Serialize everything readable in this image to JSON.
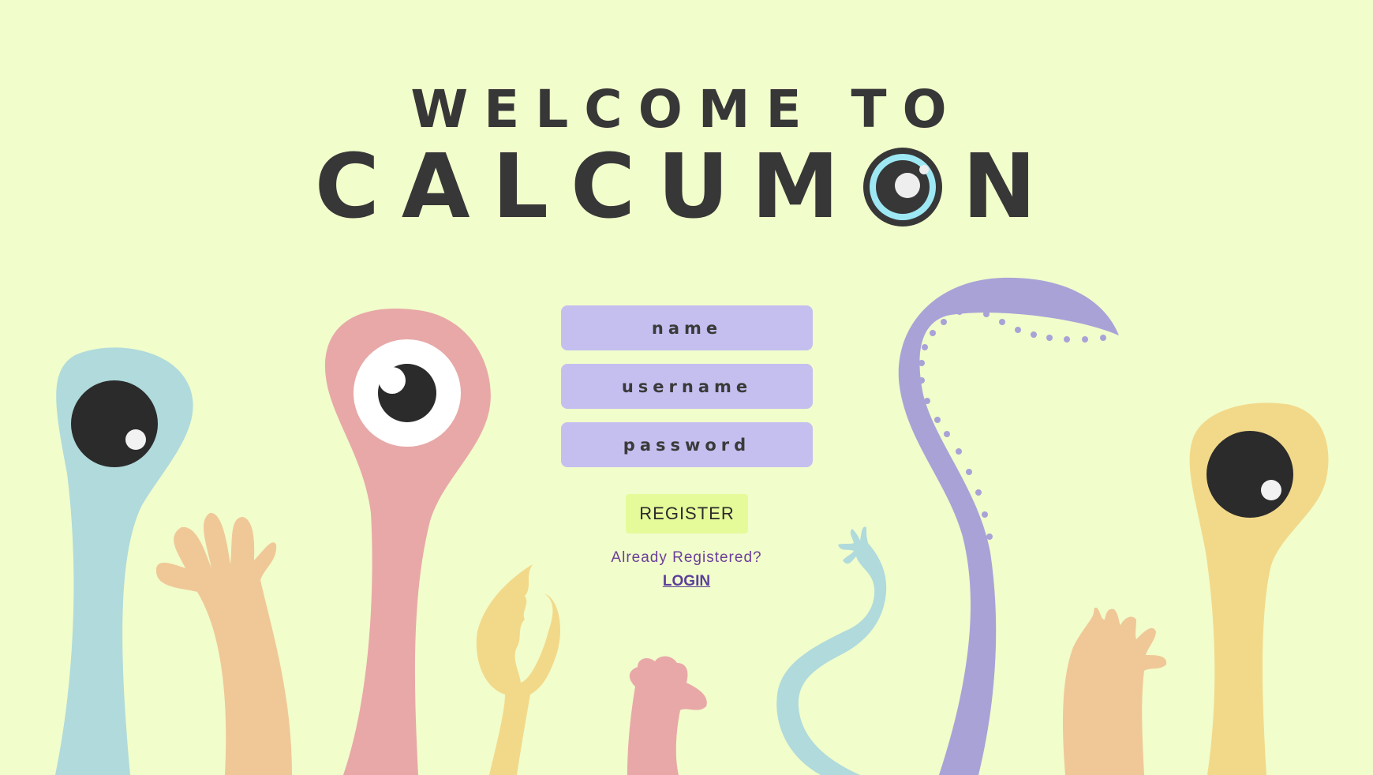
{
  "header": {
    "welcome_text": "WELCOME TO",
    "brand_prefix": "CALCUM",
    "brand_suffix": "N"
  },
  "form": {
    "name_placeholder": "name",
    "username_placeholder": "username",
    "password_placeholder": "password",
    "register_label": "REGISTER",
    "already_text": "Already Registered?",
    "login_label": "LOGIN"
  },
  "colors": {
    "background": "#f1fdcb",
    "field": "#c5bff0",
    "button": "#e5fb9a",
    "monster_blue": "#b0dadc",
    "monster_pink": "#e8a8a8",
    "monster_peach": "#f0c898",
    "monster_yellow": "#f2d98a",
    "monster_purple": "#a9a2d7"
  }
}
